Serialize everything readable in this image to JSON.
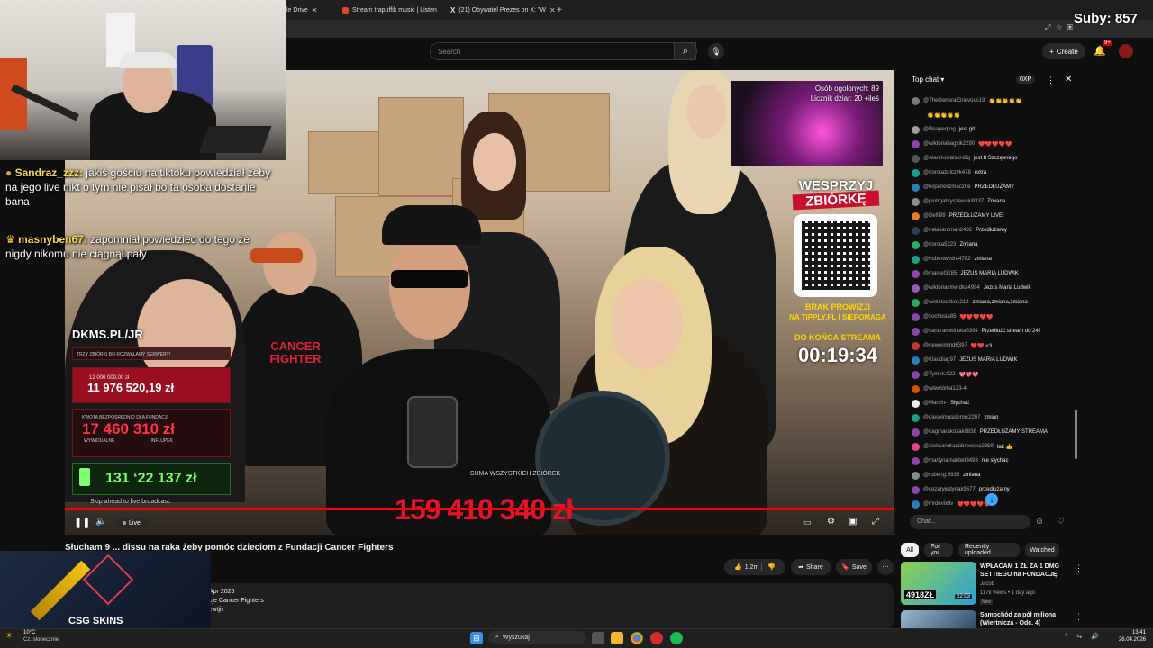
{
  "browser": {
    "tabs": [
      {
        "label": "le Drive"
      },
      {
        "label": "Stream trapuffik music | Listen"
      },
      {
        "label": "(21) Obywatel Prezes on X: \"W"
      }
    ],
    "new_tab": "+"
  },
  "overlay": {
    "subs": "Suby: 857"
  },
  "youtube": {
    "search_placeholder": "Search",
    "create_label": "Create",
    "notifications_badge": "9+",
    "video_title": "Słucham 9 ... dissu na raka żeby pomóc dzieciom z Fundacji Cancer Fighters",
    "likes": "1.2m",
    "share": "Share",
    "save": "Save",
    "desc_date": "Apr 2026",
    "desc_line1": "cje Cancer Fighters",
    "desc_line2": "zwtji)",
    "player": {
      "live_label": "Live",
      "skip_text": "Skip ahead to live broadcast."
    }
  },
  "stream": {
    "chat": [
      {
        "user": "Sandraz_zzz:",
        "text": "jakiś gościu na tiktoku powiedział żeby na jego live nikt o tym nie pisał bo ta osoba dostanie bana"
      },
      {
        "user": "masnyben67:",
        "text": "zapomniał powiedzieć do tego że nigdy nikomu nie ciągnął pały"
      }
    ],
    "dkms": "DKMS.PL/JR",
    "panel_header": "TRZY ZBIÓRKI BO ROZWALAMY SERWERY!",
    "goal1_label": "12 000 000,00 zł",
    "goal1_value": "11 976 520,19 zł",
    "goal2_label": "KWOTA BEZPOŚREDNIO DLA FUNDACJI",
    "goal2_value": "17 460 310 zł",
    "goal2_sub1": "WYWIDUALNE",
    "goal2_sub2": "INFLUPEK",
    "goal3_value": "131 ʻ22 137 zł",
    "total_label": "SUMA WSZYSTKICH ZBIÓREK",
    "total_value": "159 410 340 zł",
    "viewers_line1": "Osób ogolonych: 89",
    "viewers_line2": "Licznik dziar: 20 +ileś",
    "wesprzyj1": "WESPRZYJ",
    "wesprzyj2": "ZBIÓRKĘ",
    "brak1": "BRAK PROWIZJI",
    "brak2": "NA TIPPLY.PL I SIEPOMAGA",
    "do_konca": "DO KOŃCA STREAMA",
    "timer": "00:19:34",
    "shirt_text": "CANCER FIGHTER",
    "csgo": "CSG SKINS"
  },
  "live_chat": {
    "header": "Top chat",
    "xp": "0XP",
    "placeholder": "Chat...",
    "messages": [
      {
        "user": "@TheGeneralGrievous19",
        "msg": "👏👏👏👏👏",
        "color": "#7b7b7b"
      },
      {
        "user": "",
        "msg": "👏👏👏👏👏",
        "color": "#0f0f0f"
      },
      {
        "user": "@Reaperpog",
        "msg": "jest git",
        "color": "#9e9e9e"
      },
      {
        "user": "@wiktoriabagsik2290",
        "msg": "❤️❤️❤️❤️❤️",
        "color": "#8e44ad"
      },
      {
        "user": "@AlanKowalski-i8q",
        "msg": "jest tt Szczęsnego",
        "color": "#555"
      },
      {
        "user": "@dorotazulczyk478",
        "msg": "extra",
        "color": "#16a085"
      },
      {
        "user": "@koparkiszmaczne",
        "msg": "PRZEDŁUŻAMY",
        "color": "#2980b9"
      },
      {
        "user": "@piotrgabryszewski9337",
        "msg": "Zmiana",
        "color": "#8e8e8e"
      },
      {
        "user": "@Defil99",
        "msg": "PRZEDŁUŻAMY LIVE!",
        "color": "#e67e22"
      },
      {
        "user": "@nataliaroman2492",
        "msg": "Przedłużamy",
        "color": "#2c3e50"
      },
      {
        "user": "@dorota5223",
        "msg": "Zmiana",
        "color": "#27ae60"
      },
      {
        "user": "@hubertwydra4782",
        "msg": "zmiana",
        "color": "#16a085"
      },
      {
        "user": "@marcel3285",
        "msg": "JEZUS MARIA LUDWIK",
        "color": "#8e44ad"
      },
      {
        "user": "@wiktoriasmerdka4994",
        "msg": "Jezus Maria Ludwik",
        "color": "#9b59b6"
      },
      {
        "user": "@wioletasitko1213",
        "msg": "zmiana,zmiana,zmiana",
        "color": "#27ae60"
      },
      {
        "user": "@sochosia85",
        "msg": "❤️❤️❤️❤️❤️",
        "color": "#8e44ad"
      },
      {
        "user": "@sandraniwinska6394",
        "msg": "Przedłużć stream do 24!",
        "color": "#8e44ad"
      },
      {
        "user": "@newermind6397",
        "msg": "❤️❤️ <3",
        "color": "#c0392b"
      },
      {
        "user": "@Klaudiag97",
        "msg": "JEZUS MARIA LUDWIK",
        "color": "#2980b9"
      },
      {
        "user": "@Tymek.022",
        "msg": "💖💖💖",
        "color": "#8e44ad"
      },
      {
        "user": "@wiewiórka123-4",
        "msg": "",
        "color": "#d35400"
      },
      {
        "user": "@Marcin-",
        "msg": "Słychać",
        "color": "#eeeeee"
      },
      {
        "user": "@dieselmusidymic2207",
        "msg": "zmian",
        "color": "#16a085"
      },
      {
        "user": "@dagmarakozak8838",
        "msg": "PRZEDŁUŻAMY STREAMA",
        "color": "#8e44ad"
      },
      {
        "user": "@aleksandradabrowska2359",
        "msg": "tak 👍",
        "color": "#e84393"
      },
      {
        "user": "@martynamakbet3493",
        "msg": "nie słychac",
        "color": "#8e44ad"
      },
      {
        "user": "@robertg.9935",
        "msg": "zmiana",
        "color": "#7f8c8d"
      },
      {
        "user": "@cezaryjedynak9677",
        "msg": "przedłużamy",
        "color": "#8e44ad"
      },
      {
        "user": "@mrdevixttv",
        "msg": "❤️❤️❤️❤️❤️",
        "color": "#2980b9"
      }
    ]
  },
  "filters": {
    "chips": [
      "All",
      "For you",
      "Recently uploaded",
      "Watched"
    ]
  },
  "recommended": [
    {
      "title_line1": "WPŁACAM 1 ZŁ ZA 1 DMG",
      "title_line2": "SETTIEGO na FUNDACJĘ",
      "channel": "Jacob",
      "meta": "117k views • 1 day ago",
      "badge": "New",
      "duration": "22:03",
      "thumb_text": "4918ZŁ"
    },
    {
      "title_line1": "Samochód za pół miliona",
      "title_line2": "(Wiertnicza - Odc. 4)",
      "channel": "",
      "meta": "",
      "badge": "",
      "duration": "",
      "thumb_text": ""
    }
  ],
  "taskbar": {
    "weather_temp": "10°C",
    "weather_desc": "Cz. słonecznie",
    "search_label": "Wyszukaj",
    "time": "13:41",
    "date": "26.04.2026"
  }
}
